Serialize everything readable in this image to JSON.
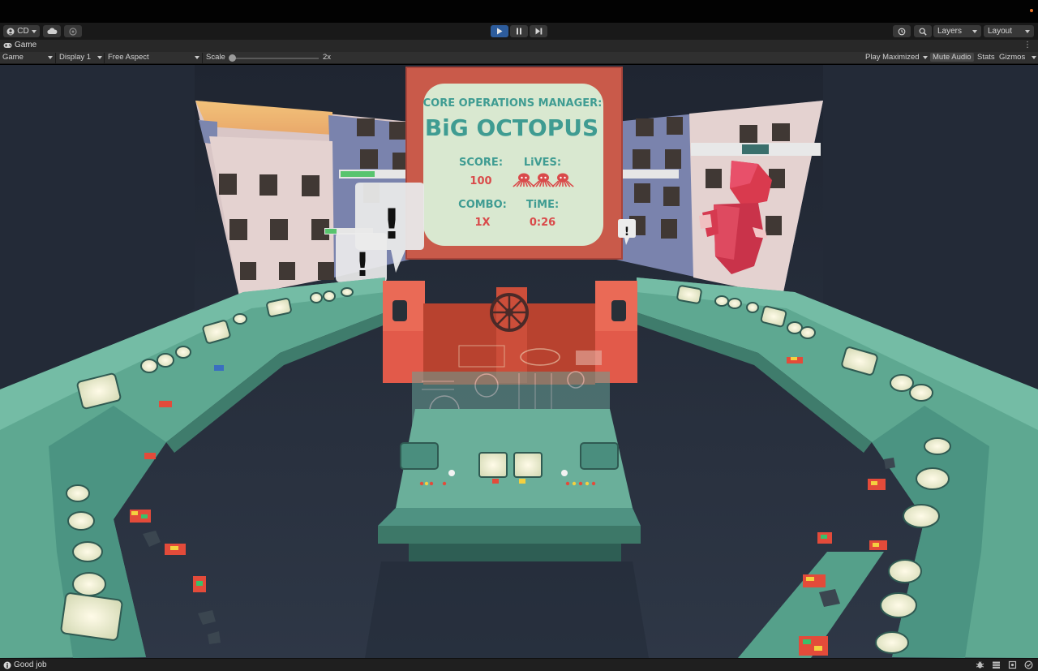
{
  "toolbar": {
    "account_label": "CD",
    "cloud_icon": "cloud-icon",
    "collab_icon": "collab-icon",
    "play_icon": "play-icon",
    "pause_icon": "pause-icon",
    "step_icon": "step-icon",
    "history_icon": "history-icon",
    "search_icon": "search-icon",
    "layers_label": "Layers",
    "layout_label": "Layout",
    "play_active_color": "#2d5c9c"
  },
  "tab": {
    "label": "Game",
    "icon": "gamepad-icon",
    "menu_glyph": "⋮"
  },
  "gamebar": {
    "view_select": "Game",
    "display_select": "Display 1",
    "aspect_select": "Free Aspect",
    "scale_label": "Scale",
    "scale_value": "2x",
    "play_maximized": "Play Maximized",
    "mute_audio": "Mute Audio",
    "stats": "Stats",
    "gizmos": "Gizmos"
  },
  "game": {
    "manager_title": "CORE OPERATIONS MANAGER:",
    "manager_name": "BiG OCTOPUS",
    "score_label": "SCORE:",
    "score_value": "100",
    "lives_label": "LiVES:",
    "lives_count": 3,
    "combo_label": "COMBO:",
    "combo_value": "1X",
    "time_label": "TiME:",
    "time_value": "0:26",
    "alert_glyph": "!",
    "colors": {
      "screen_frame": "#c95a4a",
      "screen_bg": "#d9e8d0",
      "title_text": "#3f9c92",
      "value_text": "#d94a4a",
      "console": "#5ea891",
      "floor": "#2c3544",
      "wall": "#242b38"
    }
  },
  "status": {
    "message": "Good job",
    "info_icon": "info-icon",
    "icons": [
      "bug-icon",
      "stack-icon",
      "lock-icon",
      "check-icon"
    ]
  }
}
